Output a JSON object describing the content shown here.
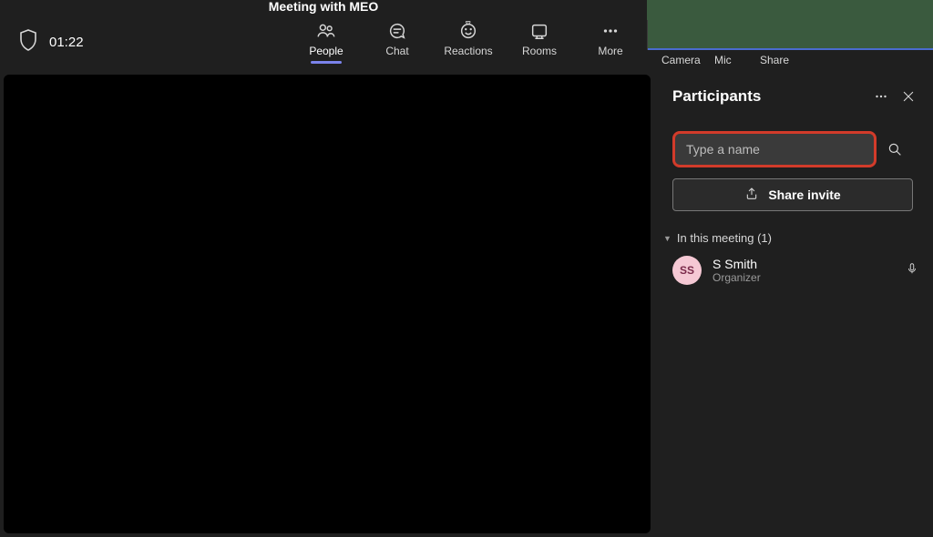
{
  "header": {
    "title": "Meeting with MEO",
    "timer": "01:22"
  },
  "toolbar": {
    "people": "People",
    "chat": "Chat",
    "reactions": "Reactions",
    "rooms": "Rooms",
    "more": "More"
  },
  "controls": {
    "camera": "Camera",
    "mic": "Mic",
    "share": "Share"
  },
  "panel": {
    "title": "Participants",
    "search_placeholder": "Type a name",
    "share_invite": "Share invite",
    "section_label": "In this meeting (1)",
    "participants": [
      {
        "initials": "SS",
        "name": "S Smith",
        "role": "Organizer"
      }
    ]
  }
}
